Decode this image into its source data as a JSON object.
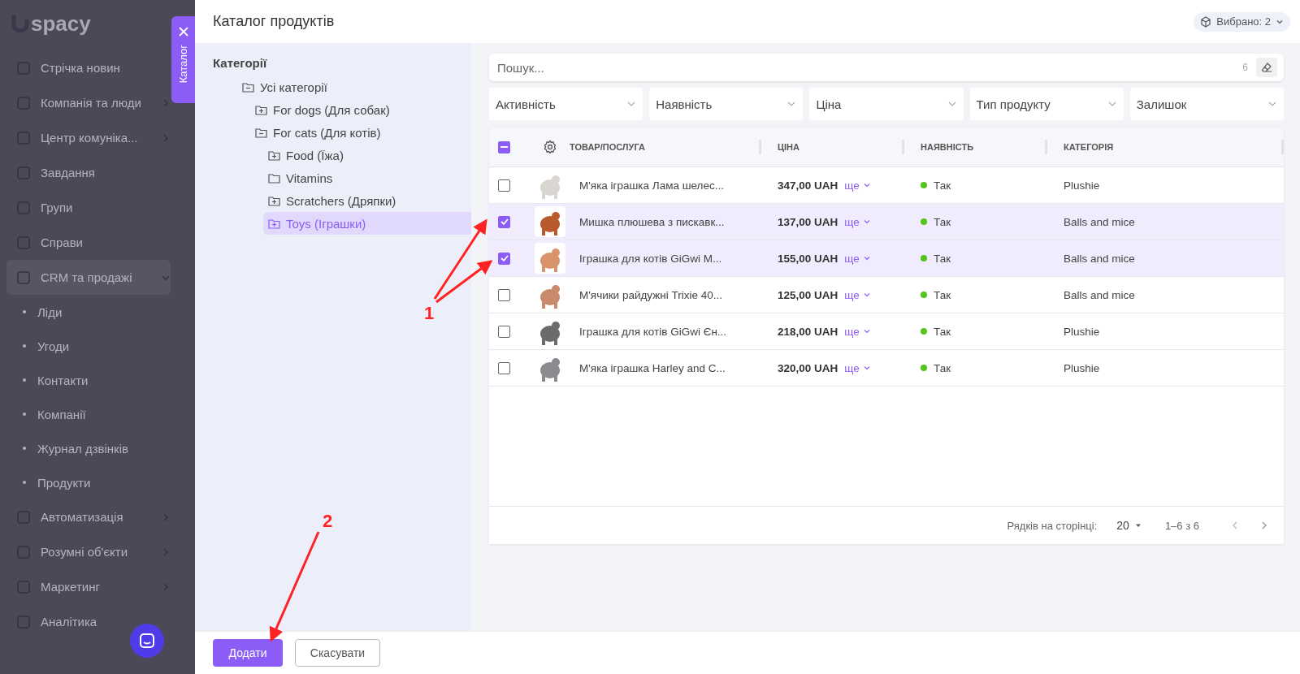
{
  "sidebar": {
    "logo": "spacy",
    "items": [
      {
        "label": "Стрічка новин",
        "kind": "link"
      },
      {
        "label": "Компанія та люди",
        "kind": "group",
        "expanded": false
      },
      {
        "label": "Центр комуніка...",
        "kind": "group",
        "expanded": false
      },
      {
        "label": "Завдання",
        "kind": "link"
      },
      {
        "label": "Групи",
        "kind": "link"
      },
      {
        "label": "Справи",
        "kind": "link"
      },
      {
        "label": "CRM та продажі",
        "kind": "group",
        "expanded": true,
        "children": [
          {
            "label": "Ліди"
          },
          {
            "label": "Угоди"
          },
          {
            "label": "Контакти"
          },
          {
            "label": "Компанії"
          },
          {
            "label": "Журнал дзвінків"
          },
          {
            "label": "Продукти"
          }
        ]
      },
      {
        "label": "Автоматизація",
        "kind": "group",
        "expanded": false
      },
      {
        "label": "Розумні об'єкти",
        "kind": "group",
        "expanded": false
      },
      {
        "label": "Маркетинг",
        "kind": "group",
        "expanded": false
      },
      {
        "label": "Аналітика",
        "kind": "link"
      }
    ]
  },
  "catalog_tab": {
    "label": "Каталог"
  },
  "modal": {
    "title": "Каталог продуктів",
    "selected_count": "Вибрано: 2"
  },
  "categories": {
    "title": "Категорії",
    "tree": [
      {
        "label": "Усі категорії",
        "kind": "branch",
        "expanded": true,
        "selected": false,
        "children": [
          {
            "label": "For dogs (Для собак)",
            "kind": "branch",
            "expanded": false,
            "selected": false
          },
          {
            "label": "For cats (Для котів)",
            "kind": "branch",
            "expanded": true,
            "selected": false,
            "children": [
              {
                "label": "Food (Їжа)",
                "kind": "branch",
                "expanded": false,
                "selected": false
              },
              {
                "label": "Vitamins",
                "kind": "leaf",
                "selected": false
              },
              {
                "label": "Scratchers (Дряпки)",
                "kind": "branch",
                "expanded": false,
                "selected": false
              },
              {
                "label": "Toys (Іграшки)",
                "kind": "branch",
                "expanded": false,
                "selected": true
              }
            ]
          }
        ]
      }
    ]
  },
  "search": {
    "placeholder": "Пошук...",
    "count": "6"
  },
  "filters": [
    "Активність",
    "Наявність",
    "Ціна",
    "Тип продукту",
    "Залишок"
  ],
  "table": {
    "select_all_indeterminate": true,
    "columns": [
      "ТОВАР/ПОСЛУГА",
      "ЦІНА",
      "НАЯВНІСТЬ",
      "КАТЕГОРІЯ"
    ],
    "rows": [
      {
        "selected": false,
        "name": "М'яка іграшка Лама шелес...",
        "price": "347,00 UAH",
        "more": "ще",
        "in_stock": true,
        "availability": "Так",
        "category": "Plushie"
      },
      {
        "selected": true,
        "name": "Мишка плюшева з пискавк...",
        "price": "137,00 UAH",
        "more": "ще",
        "in_stock": true,
        "availability": "Так",
        "category": "Balls and mice"
      },
      {
        "selected": true,
        "name": "Іграшка для котів GiGwi M...",
        "price": "155,00 UAH",
        "more": "ще",
        "in_stock": true,
        "availability": "Так",
        "category": "Balls and mice"
      },
      {
        "selected": false,
        "name": "М'ячики райдужні Trixie 40...",
        "price": "125,00 UAH",
        "more": "ще",
        "in_stock": true,
        "availability": "Так",
        "category": "Balls and mice"
      },
      {
        "selected": false,
        "name": "Іграшка для котів GiGwi Єн...",
        "price": "218,00 UAH",
        "more": "ще",
        "in_stock": true,
        "availability": "Так",
        "category": "Plushie"
      },
      {
        "selected": false,
        "name": "М'яка іграшка Harley and C...",
        "price": "320,00 UAH",
        "more": "ще",
        "in_stock": true,
        "availability": "Так",
        "category": "Plushie"
      }
    ]
  },
  "pagination": {
    "rows_label": "Рядків на сторінці:",
    "rows_per_page": "20",
    "range": "1–6 з 6"
  },
  "buttons": {
    "primary": "Додати",
    "secondary": "Скасувати"
  },
  "annotations": [
    {
      "label": "1"
    },
    {
      "label": "2"
    }
  ]
}
